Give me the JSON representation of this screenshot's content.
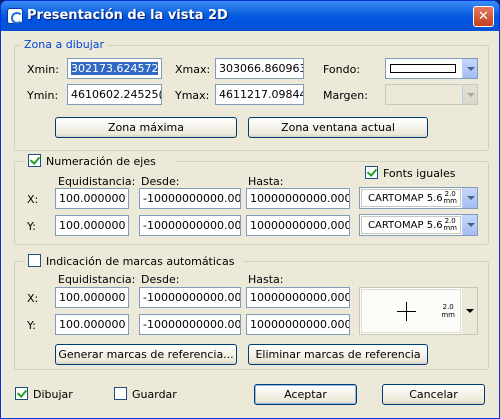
{
  "window": {
    "title": "Presentación de la vista 2D",
    "close_label": "✕"
  },
  "zona": {
    "title": "Zona a dibujar",
    "xmin_label": "Xmin:",
    "xmin_value": "302173.624572",
    "xmax_label": "Xmax:",
    "xmax_value": "303066.860963",
    "ymin_label": "Ymin:",
    "ymin_value": "4610602.24525(",
    "ymax_label": "Ymax:",
    "ymax_value": "4611217.09844€",
    "fondo_label": "Fondo:",
    "margen_label": "Margen:",
    "fondo_color": "#ffffff",
    "btn_max": "Zona máxima",
    "btn_actual": "Zona ventana actual"
  },
  "numeracion": {
    "title": "Numeración de ejes",
    "checked": true,
    "fonts_iguales_label": "Fonts iguales",
    "fonts_iguales_checked": true,
    "col_equidistancia": "Equidistancia:",
    "col_desde": "Desde:",
    "col_hasta": "Hasta:",
    "x_label": "X:",
    "y_label": "Y:",
    "x_equi": "100.000000",
    "x_desde": "-10000000000.000",
    "x_hasta": "10000000000.0000",
    "y_equi": "100.000000",
    "y_desde": "-10000000000.000",
    "y_hasta": "10000000000.0000",
    "font_name": "CARTOMAP 5.6",
    "font_size_top": "2.0",
    "font_size_unit": "mm"
  },
  "marcas": {
    "title": "Indicación de marcas automáticas",
    "checked": false,
    "col_equidistancia": "Equidistancia:",
    "col_desde": "Desde:",
    "col_hasta": "Hasta:",
    "x_label": "X:",
    "y_label": "Y:",
    "x_equi": "100.000000",
    "x_desde": "-10000000000.000",
    "x_hasta": "10000000000.0000",
    "y_equi": "100.000000",
    "y_desde": "-10000000000.000",
    "y_hasta": "10000000000.0000",
    "marker_size_top": "2.0",
    "marker_size_unit": "mm",
    "btn_generar": "Generar marcas de referencia...",
    "btn_eliminar": "Eliminar marcas de referencia"
  },
  "footer": {
    "dibujar_label": "Dibujar",
    "dibujar_checked": true,
    "guardar_label": "Guardar",
    "guardar_checked": false,
    "btn_aceptar": "Aceptar",
    "btn_cancelar": "Cancelar"
  }
}
